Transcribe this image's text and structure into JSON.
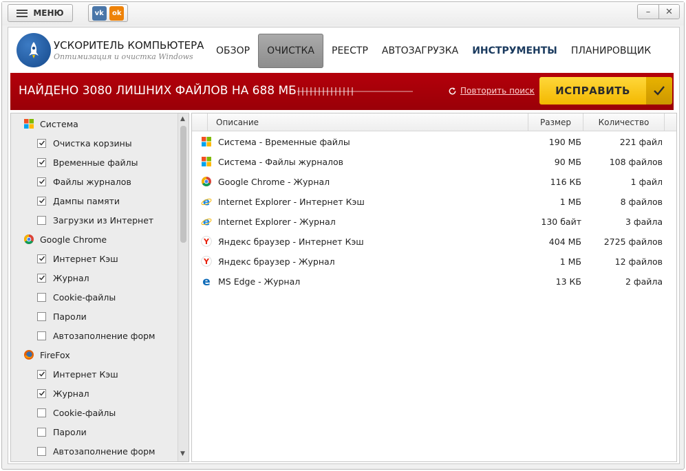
{
  "titlebar": {
    "menu_label": "МЕНЮ",
    "vk_label": "vk",
    "ok_label": "ok",
    "minimize": "–",
    "close": "✕"
  },
  "brand": {
    "title": "УСКОРИТЕЛЬ КОМПЬЮТЕРА",
    "subtitle": "Оптимизация и очистка Windows"
  },
  "nav": [
    {
      "label": "ОБЗОР",
      "active": false,
      "bold": false
    },
    {
      "label": "ОЧИСТКА",
      "active": true,
      "bold": false
    },
    {
      "label": "РЕЕСТР",
      "active": false,
      "bold": false
    },
    {
      "label": "АВТОЗАГРУЗКА",
      "active": false,
      "bold": false
    },
    {
      "label": "ИНСТРУМЕНТЫ",
      "active": false,
      "bold": true
    },
    {
      "label": "ПЛАНИРОВЩИК",
      "active": false,
      "bold": false
    }
  ],
  "banner": {
    "text": "НАЙДЕНО 3080 ЛИШНИХ ФАЙЛОВ НА 688 МБ",
    "repeat_label": "Повторить поиск",
    "fix_label": "ИСПРАВИТЬ"
  },
  "tree": [
    {
      "type": "group",
      "label": "Система",
      "icon": "windows-icon"
    },
    {
      "type": "child",
      "label": "Очистка корзины",
      "checked": true
    },
    {
      "type": "child",
      "label": "Временные файлы",
      "checked": true
    },
    {
      "type": "child",
      "label": "Файлы журналов",
      "checked": true
    },
    {
      "type": "child",
      "label": "Дампы памяти",
      "checked": true
    },
    {
      "type": "child",
      "label": "Загрузки из Интернет",
      "checked": false
    },
    {
      "type": "group",
      "label": "Google Chrome",
      "icon": "chrome-icon"
    },
    {
      "type": "child",
      "label": "Интернет Кэш",
      "checked": true
    },
    {
      "type": "child",
      "label": "Журнал",
      "checked": true
    },
    {
      "type": "child",
      "label": "Cookie-файлы",
      "checked": false
    },
    {
      "type": "child",
      "label": "Пароли",
      "checked": false
    },
    {
      "type": "child",
      "label": "Автозаполнение форм",
      "checked": false
    },
    {
      "type": "group",
      "label": "FireFox",
      "icon": "firefox-icon"
    },
    {
      "type": "child",
      "label": "Интернет Кэш",
      "checked": true
    },
    {
      "type": "child",
      "label": "Журнал",
      "checked": true
    },
    {
      "type": "child",
      "label": "Cookie-файлы",
      "checked": false
    },
    {
      "type": "child",
      "label": "Пароли",
      "checked": false
    },
    {
      "type": "child",
      "label": "Автозаполнение форм",
      "checked": false
    }
  ],
  "table": {
    "headers": {
      "description": "Описание",
      "size": "Размер",
      "count": "Количество"
    },
    "rows": [
      {
        "icon": "windows-icon",
        "description": "Система - Временные файлы",
        "size": "190 МБ",
        "count": "221 файл"
      },
      {
        "icon": "windows-icon",
        "description": "Система - Файлы журналов",
        "size": "90 МБ",
        "count": "108 файлов"
      },
      {
        "icon": "chrome-icon",
        "description": "Google Chrome - Журнал",
        "size": "116 КБ",
        "count": "1 файл"
      },
      {
        "icon": "ie-icon",
        "description": "Internet Explorer - Интернет Кэш",
        "size": "1 МБ",
        "count": "8 файлов"
      },
      {
        "icon": "ie-icon",
        "description": "Internet Explorer - Журнал",
        "size": "130 байт",
        "count": "3 файла"
      },
      {
        "icon": "yandex-icon",
        "description": "Яндекс браузер - Интернет Кэш",
        "size": "404 МБ",
        "count": "2725 файлов"
      },
      {
        "icon": "yandex-icon",
        "description": "Яндекс браузер - Журнал",
        "size": "1 МБ",
        "count": "12 файлов"
      },
      {
        "icon": "edge-icon",
        "description": "MS Edge - Журнал",
        "size": "13 КБ",
        "count": "2 файла"
      }
    ]
  },
  "colors": {
    "banner": "#a8000a",
    "fix_button": "#f7c400",
    "nav_active": "#9a9a9a",
    "nav_bold": "#1a3a5e"
  }
}
